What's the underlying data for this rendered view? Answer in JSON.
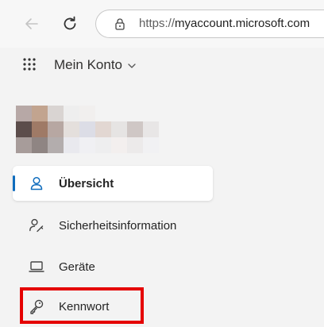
{
  "browser": {
    "url_scheme": "https://",
    "url_host": "myaccount.microsoft.com",
    "back_icon": "arrow-left-icon",
    "refresh_icon": "refresh-icon",
    "lock_icon": "lock-icon"
  },
  "header": {
    "app_launcher_icon": "waffle-icon",
    "title": "Mein Konto"
  },
  "nav": {
    "items": [
      {
        "label": "Übersicht",
        "icon": "person-icon",
        "active": true
      },
      {
        "label": "Sicherheitsinformation",
        "icon": "person-key-icon",
        "active": false
      },
      {
        "label": "Geräte",
        "icon": "laptop-icon",
        "active": false
      },
      {
        "label": "Kennwort",
        "icon": "key-icon",
        "active": false
      }
    ]
  },
  "colors": {
    "accent": "#0f6cbd",
    "highlight": "#e50000",
    "background": "#f3f3f3"
  }
}
